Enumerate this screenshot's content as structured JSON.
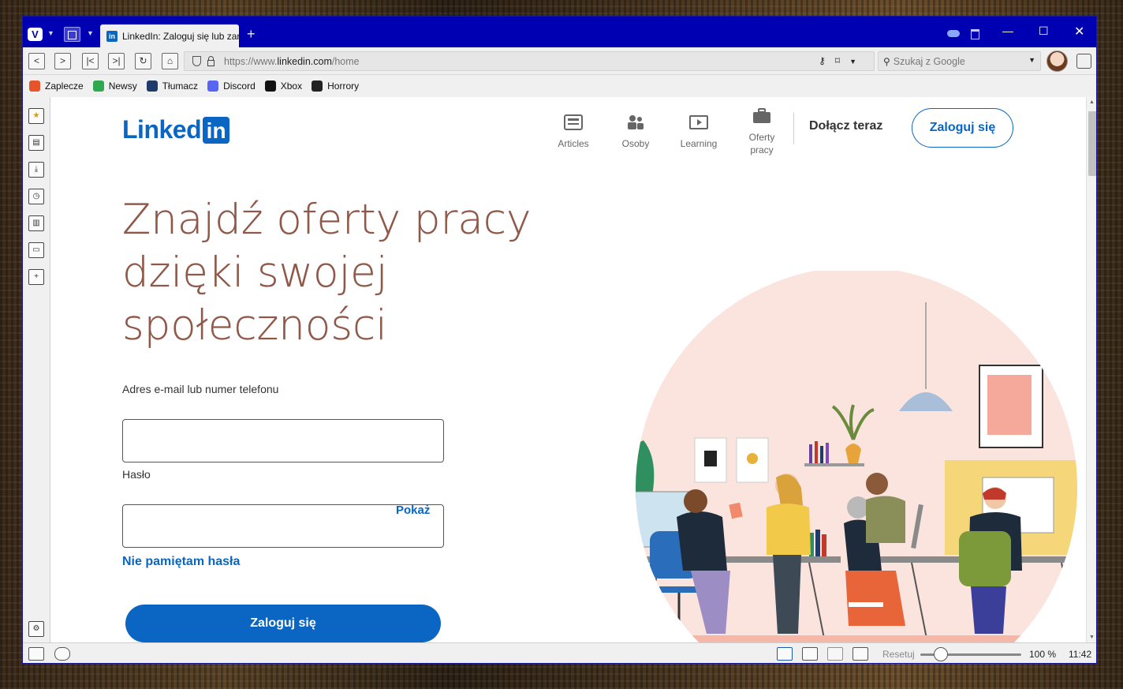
{
  "browser": {
    "tab_title": "LinkedIn: Zaloguj się lub zar",
    "url_prefix": "https://www.",
    "url_domain": "linkedin.com",
    "url_path": "/home",
    "search_placeholder": "Szukaj z Google",
    "accent_color": "#0000b3"
  },
  "bookmarks": [
    {
      "label": "Zaplecze",
      "color": "#e8542a"
    },
    {
      "label": "Newsy",
      "color": "#2fa84f"
    },
    {
      "label": "Tłumacz",
      "color": "#1f3b6b"
    },
    {
      "label": "Discord",
      "color": "#5865f2"
    },
    {
      "label": "Xbox",
      "color": "#111111"
    },
    {
      "label": "Horrory",
      "color": "#222222"
    }
  ],
  "page": {
    "nav": {
      "articles": "Articles",
      "people": "Osoby",
      "learning": "Learning",
      "jobs_line1": "Oferty",
      "jobs_line2": "pracy",
      "join": "Dołącz teraz",
      "signin": "Zaloguj się"
    },
    "hero": {
      "line1": "Znajdź oferty pracy",
      "line2": "dzięki swojej",
      "line3": "społeczności"
    },
    "form": {
      "email_label": "Adres e-mail lub numer telefonu",
      "password_label": "Hasło",
      "show_password": "Pokaż",
      "forgot": "Nie pamiętam hasła",
      "submit": "Zaloguj się"
    },
    "brand_color": "#0a66c2"
  },
  "statusbar": {
    "reset": "Resetuj",
    "zoom": "100 %",
    "time": "11:42",
    "zoom_fraction": 0.2
  }
}
